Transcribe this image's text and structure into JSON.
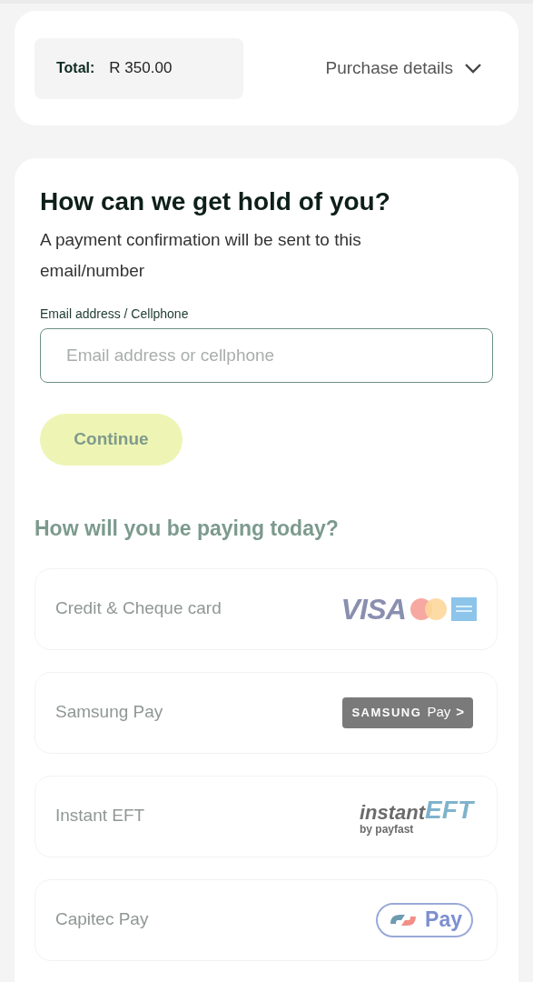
{
  "summary": {
    "total_label": "Total:",
    "total_value": "R 350.00",
    "details_toggle": "Purchase details",
    "expanded": false
  },
  "contact": {
    "heading": "How can we get hold of you?",
    "description": "A payment confirmation will be sent to this email/number",
    "field_label": "Email address / Cellphone",
    "placeholder": "Email address or cellphone",
    "continue_button": "Continue",
    "continue_disabled": true
  },
  "payment": {
    "heading": "How will you be paying today?",
    "methods": [
      {
        "label": "Credit & Cheque card",
        "kind": "cards",
        "logo_texts": [
          "VISA"
        ],
        "disabled": true
      },
      {
        "label": "Samsung Pay",
        "kind": "samsung",
        "logo_texts": [
          "SAMSUNG",
          "Pay",
          ">"
        ],
        "disabled": true
      },
      {
        "label": "Instant EFT",
        "kind": "eft",
        "logo_texts": [
          "instant",
          "EFT",
          "by payfast"
        ],
        "disabled": true
      },
      {
        "label": "Capitec Pay",
        "kind": "capitec",
        "logo_texts": [
          "Pay"
        ],
        "disabled": true
      }
    ]
  }
}
